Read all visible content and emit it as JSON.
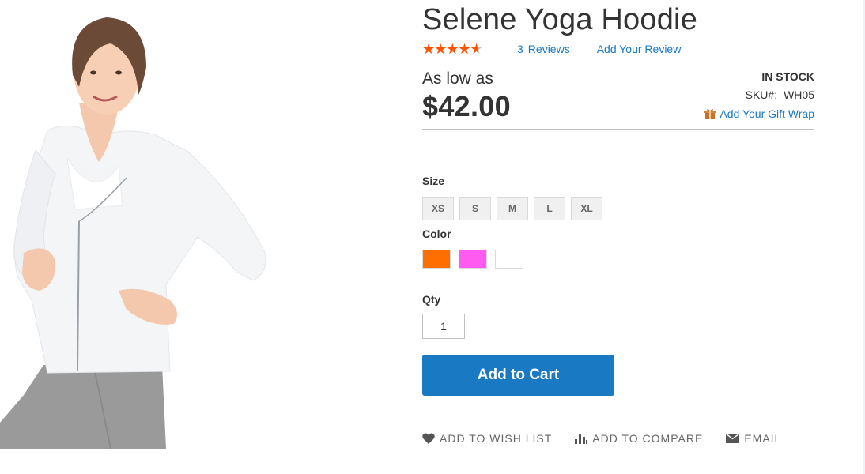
{
  "product": {
    "title": "Selene Yoga Hoodie",
    "rating": {
      "stars_total": 5,
      "stars_filled_fraction": 0.8,
      "color": "#ff5501",
      "empty_color": "#c7c7c7"
    },
    "reviews": {
      "count": "3",
      "label": "Reviews",
      "add_label": "Add Your Review"
    },
    "price": {
      "as_low_as": "As low as",
      "amount": "$42.00"
    },
    "stock": "IN STOCK",
    "sku": {
      "label": "SKU#:",
      "value": "WH05"
    },
    "gift_wrap": {
      "label": "Add Your Gift Wrap",
      "icon": "gift-icon"
    }
  },
  "options": {
    "size": {
      "label": "Size",
      "values": [
        "XS",
        "S",
        "M",
        "L",
        "XL"
      ]
    },
    "color": {
      "label": "Color",
      "swatches": [
        "#ff6e00",
        "#ff5bf0",
        "#ffffff"
      ]
    },
    "qty": {
      "label": "Qty",
      "value": "1"
    }
  },
  "cart": {
    "button_label": "Add to Cart",
    "accent": "#1979c3"
  },
  "actions": {
    "wishlist": {
      "label": "ADD TO WISH LIST",
      "icon": "heart-icon"
    },
    "compare": {
      "label": "ADD TO COMPARE",
      "icon": "bar-chart-icon"
    },
    "email": {
      "label": "EMAIL",
      "icon": "envelope-icon"
    }
  }
}
